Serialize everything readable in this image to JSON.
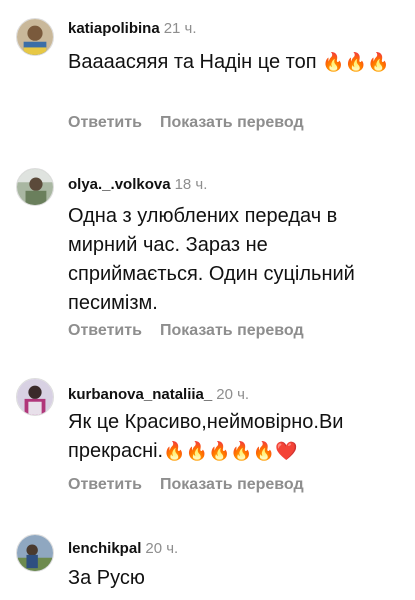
{
  "comments": [
    {
      "username": "katiapolibina",
      "time": "21 ч.",
      "text": "Ваааасяяя та Надін це топ",
      "emojis": "🔥🔥🔥",
      "reply": "Ответить",
      "translate": "Показать перевод"
    },
    {
      "username": "olya._.volkova",
      "time": "18 ч.",
      "text": "Одна з улюблених передач в мирний час. Зараз не сприймається. Один суцільний песимізм.",
      "reply": "Ответить",
      "translate": "Показать перевод"
    },
    {
      "username": "kurbanova_nataliia_",
      "time": "20 ч.",
      "text": "Як це Красиво,неймовірно.Ви прекрасні.",
      "emojis": "🔥🔥🔥🔥🔥❤️",
      "reply": "Ответить",
      "translate": "Показать перевод"
    },
    {
      "username": "lenchikpal",
      "time": "20 ч.",
      "text": "За Русю"
    }
  ]
}
